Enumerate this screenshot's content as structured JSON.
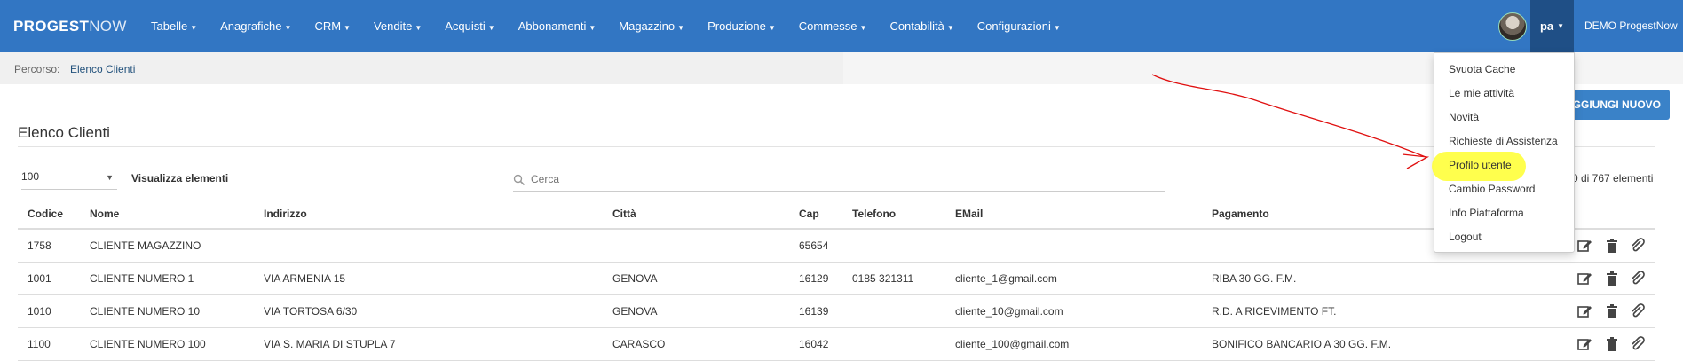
{
  "navbar": {
    "brand_bold": "PROGEST",
    "brand_light": "NOW",
    "menus": [
      {
        "label": "Tabelle"
      },
      {
        "label": "Anagrafiche"
      },
      {
        "label": "CRM"
      },
      {
        "label": "Vendite"
      },
      {
        "label": "Acquisti"
      },
      {
        "label": "Abbonamenti"
      },
      {
        "label": "Magazzino"
      },
      {
        "label": "Produzione"
      },
      {
        "label": "Commesse"
      },
      {
        "label": "Contabilità"
      },
      {
        "label": "Configurazioni"
      }
    ],
    "user": "pa",
    "company": "DEMO ProgestNow"
  },
  "breadcrumb": {
    "label": "Percorso:",
    "current": "Elenco Clienti"
  },
  "page": {
    "title": "Elenco Clienti",
    "add_button": "AGGIUNGI NUOVO",
    "page_size": "100",
    "page_size_label": "Visualizza elementi",
    "search_placeholder": "Cerca",
    "count_text": "0 di 767 elementi"
  },
  "table": {
    "headers": [
      "Codice",
      "Nome",
      "Indirizzo",
      "Città",
      "Cap",
      "Telefono",
      "EMail",
      "Pagamento"
    ],
    "rows": [
      {
        "codice": "1758",
        "nome": "CLIENTE MAGAZZINO",
        "indirizzo": "",
        "citta": "",
        "cap": "65654",
        "telefono": "",
        "email": "",
        "pagamento": ""
      },
      {
        "codice": "1001",
        "nome": "CLIENTE NUMERO 1",
        "indirizzo": "VIA ARMENIA 15",
        "citta": "GENOVA",
        "cap": "16129",
        "telefono": "0185 321311",
        "email": "cliente_1@gmail.com",
        "pagamento": "RIBA 30 GG. F.M."
      },
      {
        "codice": "1010",
        "nome": "CLIENTE NUMERO 10",
        "indirizzo": "VIA TORTOSA 6/30",
        "citta": "GENOVA",
        "cap": "16139",
        "telefono": "",
        "email": "cliente_10@gmail.com",
        "pagamento": "R.D. A RICEVIMENTO FT."
      },
      {
        "codice": "1100",
        "nome": "CLIENTE NUMERO 100",
        "indirizzo": "VIA S. MARIA DI STUPLA 7",
        "citta": "CARASCO",
        "cap": "16042",
        "telefono": "",
        "email": "cliente_100@gmail.com",
        "pagamento": "BONIFICO BANCARIO A 30 GG. F.M."
      }
    ]
  },
  "user_menu": {
    "items": [
      {
        "label": "Svuota Cache"
      },
      {
        "label": "Le mie attività"
      },
      {
        "label": "Novità"
      },
      {
        "label": "Richieste di Assistenza"
      },
      {
        "label": "Profilo utente"
      },
      {
        "label": "Cambio Password"
      },
      {
        "label": "Info Piattaforma"
      },
      {
        "label": "Logout"
      }
    ]
  },
  "icons": {
    "edit": "edit-icon",
    "delete": "trash-icon",
    "attach": "paperclip-icon",
    "search": "search-icon"
  },
  "colors": {
    "navbar": "#3276c3",
    "active_user": "#1f4f86",
    "highlight": "#ffff3a",
    "annotation_arrow": "#e01010"
  }
}
